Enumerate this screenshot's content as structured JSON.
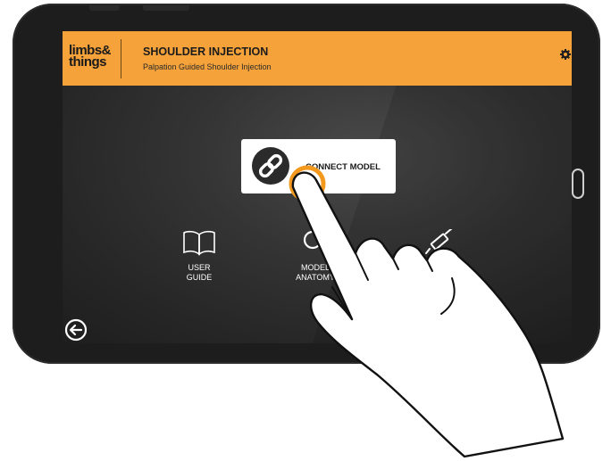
{
  "app": {
    "logo_line1": "limbs&",
    "logo_line2": "things",
    "title": "SHOULDER INJECTION",
    "subtitle": "Palpation Guided Shoulder Injection"
  },
  "connect": {
    "label": "CONNECT MODEL",
    "icon": "link-icon"
  },
  "menu": {
    "user_guide": {
      "line1": "USER",
      "line2": "GUIDE",
      "icon": "book-icon"
    },
    "model_anatomy": {
      "line1": "MODEL",
      "line2": "ANATOMY",
      "icon": "magnifier-icon"
    },
    "injection": {
      "icon": "syringe-icon"
    }
  },
  "colors": {
    "header": "#f5a23a",
    "accent_ring": "#f39a1e",
    "screen_bg": "#2e2e2e"
  }
}
